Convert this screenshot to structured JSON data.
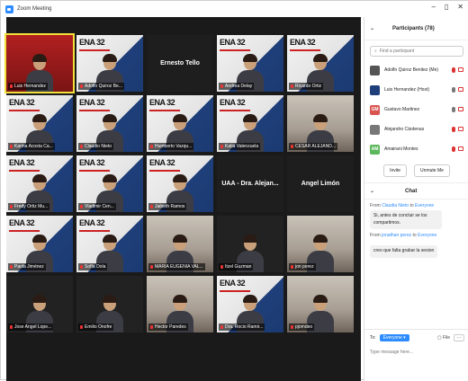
{
  "window": {
    "title": "Zoom Meeting",
    "minimize": "–",
    "maximize": "▯",
    "close": "✕"
  },
  "tiles": [
    {
      "label": "Luis Hernandez",
      "style": "red",
      "active": true
    },
    {
      "label": "Adolfo Quiroz Be...",
      "style": "poster"
    },
    {
      "label": "Ernesto Tello",
      "style": "name"
    },
    {
      "label": "Andrea Delay",
      "style": "poster"
    },
    {
      "label": "Ricardo Ortiz",
      "style": "poster"
    },
    {
      "label": "Karina Acosta Ca...",
      "style": "poster"
    },
    {
      "label": "Claudio Nieto",
      "style": "poster"
    },
    {
      "label": "Humberto Vazqu...",
      "style": "poster"
    },
    {
      "label": "Katia Valenzuela",
      "style": "poster"
    },
    {
      "label": "CESAR ALEJAND...",
      "style": "room"
    },
    {
      "label": "Fredy Ortiz Mu...",
      "style": "poster"
    },
    {
      "label": "Vladimir Cen...",
      "style": "poster"
    },
    {
      "label": "Jaibeth Ramos",
      "style": "poster"
    },
    {
      "label": "UAA - Dra. Alejan...",
      "style": "name"
    },
    {
      "label": "Angel Limón",
      "style": "name"
    },
    {
      "label": "Paola Jiménez",
      "style": "poster"
    },
    {
      "label": "Sofía Dola",
      "style": "poster"
    },
    {
      "label": "MARIA EUGENIA VAL...",
      "style": "room"
    },
    {
      "label": "Itzel Guzman",
      "style": "dark"
    },
    {
      "label": "jon perez",
      "style": "room"
    },
    {
      "label": "Jose Angel Lope...",
      "style": "dark"
    },
    {
      "label": "Emilio Onofre",
      "style": "dark"
    },
    {
      "label": "Hector Paredes",
      "style": "room"
    },
    {
      "label": "Dra. Rocio Ramir...",
      "style": "poster"
    },
    {
      "label": "pjomdeo",
      "style": "room"
    }
  ],
  "tile_names": {
    "tile2": "Ernesto Tello",
    "tile13": "UAA - Dra. Alejan...",
    "tile14": "Angel Limón"
  },
  "participants": {
    "header": "Participants (78)",
    "search_placeholder": "Find a participant",
    "items": [
      {
        "name": "Adolfo Quiroz Benitez (Me)",
        "avatar_color": "#555555",
        "initials": ""
      },
      {
        "name": "Luis Hernandez (Host)",
        "avatar_color": "#1f3f7a",
        "initials": ""
      },
      {
        "name": "Gustavo Martinez",
        "avatar_color": "#d9534f",
        "initials": "GM"
      },
      {
        "name": "Alejandro Cárdenas",
        "avatar_color": "#777777",
        "initials": ""
      },
      {
        "name": "Amairani Montes",
        "avatar_color": "#5cb85c",
        "initials": "AM"
      }
    ],
    "invite_label": "Invite",
    "unmute_label": "Unmute Me"
  },
  "chat": {
    "header": "Chat",
    "messages": [
      {
        "from_label": "From",
        "sender": "Claudia Nieto",
        "to_label": "to",
        "recipient": "Everyone",
        "text": "Si, antes de concluir se los compartimos."
      },
      {
        "from_label": "From",
        "sender": "jonathan perez",
        "to_label": "to",
        "recipient": "Everyone",
        "text": "creo que falta grabar la sesion"
      }
    ],
    "to_label": "To:",
    "to_value": "Everyone ▾",
    "file_label": "File",
    "more_label": "···",
    "input_placeholder": "Type message here..."
  },
  "colors": {
    "accent": "#2D8CFF",
    "mute_red": "#dd3333",
    "active_speaker": "#f2e03a"
  }
}
